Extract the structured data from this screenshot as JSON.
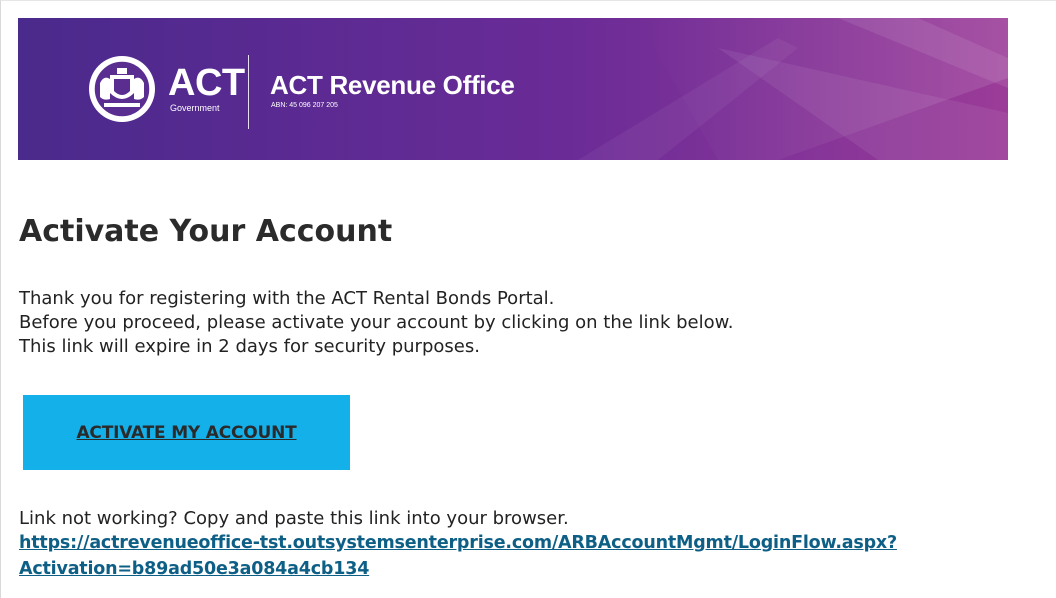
{
  "banner": {
    "brand": "ACT",
    "brand_sub": "Government",
    "office_name": "ACT Revenue Office",
    "abn": "ABN: 45 096 207 205",
    "logo_icon": "act-coat-of-arms-icon",
    "colors": {
      "gradient_start": "#4a2a8c",
      "gradient_mid": "#6a2b97",
      "gradient_end": "#9b3c98"
    }
  },
  "email": {
    "heading": "Activate Your Account",
    "body_lines": [
      "Thank you for registering with the ACT Rental Bonds Portal.",
      "Before you proceed, please activate your account by clicking on the link below.",
      "This link will expire in 2 days for security purposes."
    ],
    "cta_label": "ACTIVATE MY ACCOUNT",
    "fallback_text": "Link not working? Copy and paste this link into your browser.",
    "activation_link_line1": "https://actrevenueoffice-tst.outsystemsenterprise.com/ARBAccountMgmt/LoginFlow.aspx?",
    "activation_link_line2": "Activation=b89ad50e3a084a4cb134",
    "colors": {
      "cta_background": "#14b0ea",
      "link": "#0e5f86"
    }
  }
}
